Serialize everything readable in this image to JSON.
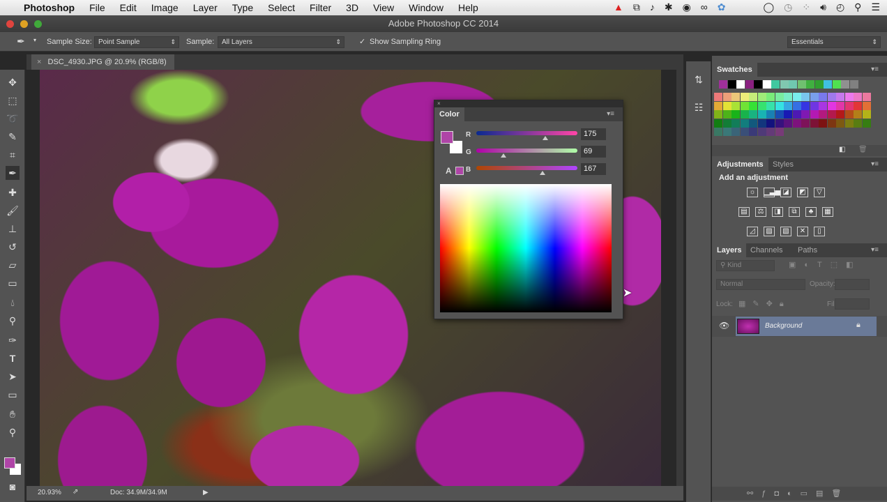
{
  "menubar": {
    "app": "Photoshop",
    "items": [
      "File",
      "Edit",
      "Image",
      "Layer",
      "Type",
      "Select",
      "Filter",
      "3D",
      "View",
      "Window",
      "Help"
    ]
  },
  "window": {
    "title": "Adobe Photoshop CC 2014"
  },
  "options": {
    "sample_size_label": "Sample Size:",
    "sample_size_value": "Point Sample",
    "sample_label": "Sample:",
    "sample_value": "All Layers",
    "show_ring_label": "Show Sampling Ring",
    "show_ring_checked": true,
    "workspace": "Essentials"
  },
  "document": {
    "tab": "DSC_4930.JPG @ 20.9% (RGB/8)",
    "zoom": "20.93%",
    "doc_size": "Doc: 34.9M/34.9M"
  },
  "color_panel": {
    "title": "Color",
    "r_label": "R",
    "g_label": "G",
    "b_label": "B",
    "r": "175",
    "g": "69",
    "b": "167",
    "r_pct": 0.686,
    "g_pct": 0.27,
    "b_pct": 0.655,
    "foreground": "#af45a7",
    "background": "#ffffff"
  },
  "swatches": {
    "title": "Swatches",
    "recent": [
      "#a0309a",
      "#000000",
      "#ffffff",
      "#8a2080",
      "#000000",
      "#ffffff",
      "#40c8a0",
      "#80c8b0",
      "#70c8b0",
      "#70c070",
      "#40b040",
      "#30a030",
      "#40c0e0",
      "#50e050",
      "#909090",
      "#808080"
    ]
  },
  "adjustments": {
    "tab": "Adjustments",
    "tab2": "Styles",
    "heading": "Add an adjustment"
  },
  "layers": {
    "tabs": [
      "Layers",
      "Channels",
      "Paths"
    ],
    "kind": "Kind",
    "blend": "Normal",
    "opacity_label": "Opacity:",
    "lock_label": "Lock:",
    "fill_label": "Fill:",
    "layer_name": "Background"
  }
}
